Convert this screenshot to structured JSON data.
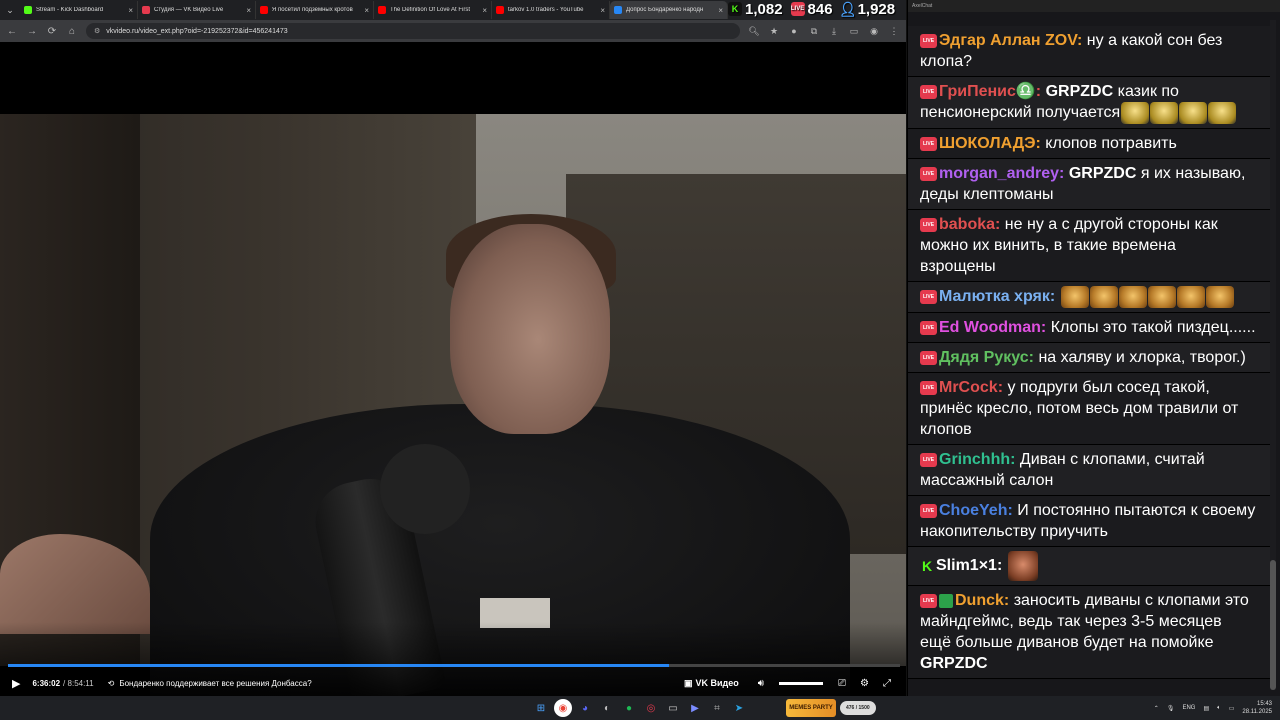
{
  "browser": {
    "tabs": [
      {
        "title": "Stream - Kick Dashboard",
        "color": "#53fc18"
      },
      {
        "title": "Студия — VK Видео Live",
        "color": "#e53a4e"
      },
      {
        "title": "Я посетил подземных кротов",
        "color": "#ff0000"
      },
      {
        "title": "The Definition Of Love At First",
        "color": "#ff0000"
      },
      {
        "title": "tarkov 1.0 traders - YouTube",
        "color": "#ff0000"
      },
      {
        "title": "Допрос Бондаренко народн",
        "color": "#2787f5"
      }
    ],
    "url": "vkvideo.ru/video_ext.php?oid=-219252372&id=456241473"
  },
  "stats": {
    "kick_viewers": "1,082",
    "vk_viewers": "846",
    "total_viewers": "1,928"
  },
  "player": {
    "current_time": "6:36:02",
    "separator": "/",
    "total_time": "8:54:11",
    "title": "Бондаренко поддерживает все решения Донбасса?",
    "brand": "VK Видео",
    "progress": 0.741
  },
  "chat": {
    "app_title": "AxelChat",
    "messages": [
      {
        "badge": "LIVE",
        "nick": "Эдгар Аллан ZOV",
        "nick_color": "#f0a030",
        "text": "ну а какой сон без клопа?",
        "emotes": ""
      },
      {
        "badge": "LIVE",
        "nick": "ГриПенис♎",
        "nick_color": "#e05050",
        "mention": "GRPZDC",
        "text": "казик по пенсионерский получается",
        "emotes": "gold4"
      },
      {
        "badge": "LIVE",
        "nick": "ШОКОЛАДЭ",
        "nick_color": "#f0a030",
        "text": "клопов потравить",
        "emotes": ""
      },
      {
        "badge": "LIVE",
        "nick": "morgan_andrey",
        "nick_color": "#b060f0",
        "mention": "GRPZDC",
        "text": "я их называю, деды клептоманы",
        "emotes": ""
      },
      {
        "badge": "LIVE",
        "nick": "baboka",
        "nick_color": "#e05050",
        "text": "не ну а с другой стороны как можно их винить, в такие времена взрощены",
        "emotes": ""
      },
      {
        "badge": "LIVE",
        "nick": "Малютка хряк",
        "nick_color": "#7ab0f0",
        "text": "",
        "emotes": "face6"
      },
      {
        "badge": "LIVE",
        "nick": "Ed Woodman",
        "nick_color": "#e050e0",
        "text": "Клопы это такой пиздец......",
        "emotes": ""
      },
      {
        "badge": "LIVE",
        "nick": "Дядя Рукус",
        "nick_color": "#60c060",
        "text": "на халяву и хлорка, творог.)",
        "emotes": ""
      },
      {
        "badge": "LIVE",
        "nick": "MrCock",
        "nick_color": "#e05050",
        "text": "у подруги был сосед такой, принёс кресло, потом весь дом травили от клопов",
        "emotes": ""
      },
      {
        "badge": "LIVE",
        "nick": "Grinchhh",
        "nick_color": "#30c090",
        "text": "Диван с клопами, считай массажный салон",
        "emotes": ""
      },
      {
        "badge": "LIVE",
        "nick": "ChoeYeh",
        "nick_color": "#4a80e0",
        "text": "И постоянно пытаются к своему накопительству приучить",
        "emotes": ""
      },
      {
        "badge": "KICK",
        "nick": "Slim1×1",
        "nick_color": "#ffffff",
        "text": "",
        "emotes": "man1"
      },
      {
        "badge": "LIVE",
        "nick": "Dunck",
        "nick_color": "#f0a030",
        "text": "заносить диваны с клопами это майндгеймс, ведь так через 3-5 месяцев ещё больше диванов будет на помойке",
        "mention_end": "GRPZDC",
        "emotes": ""
      }
    ]
  },
  "taskbar": {
    "widget_name": "MEMES PARTY",
    "widget_counter": "476 / 1500",
    "lang": "ENG",
    "time": "15:43",
    "date": "28.11.2025"
  }
}
